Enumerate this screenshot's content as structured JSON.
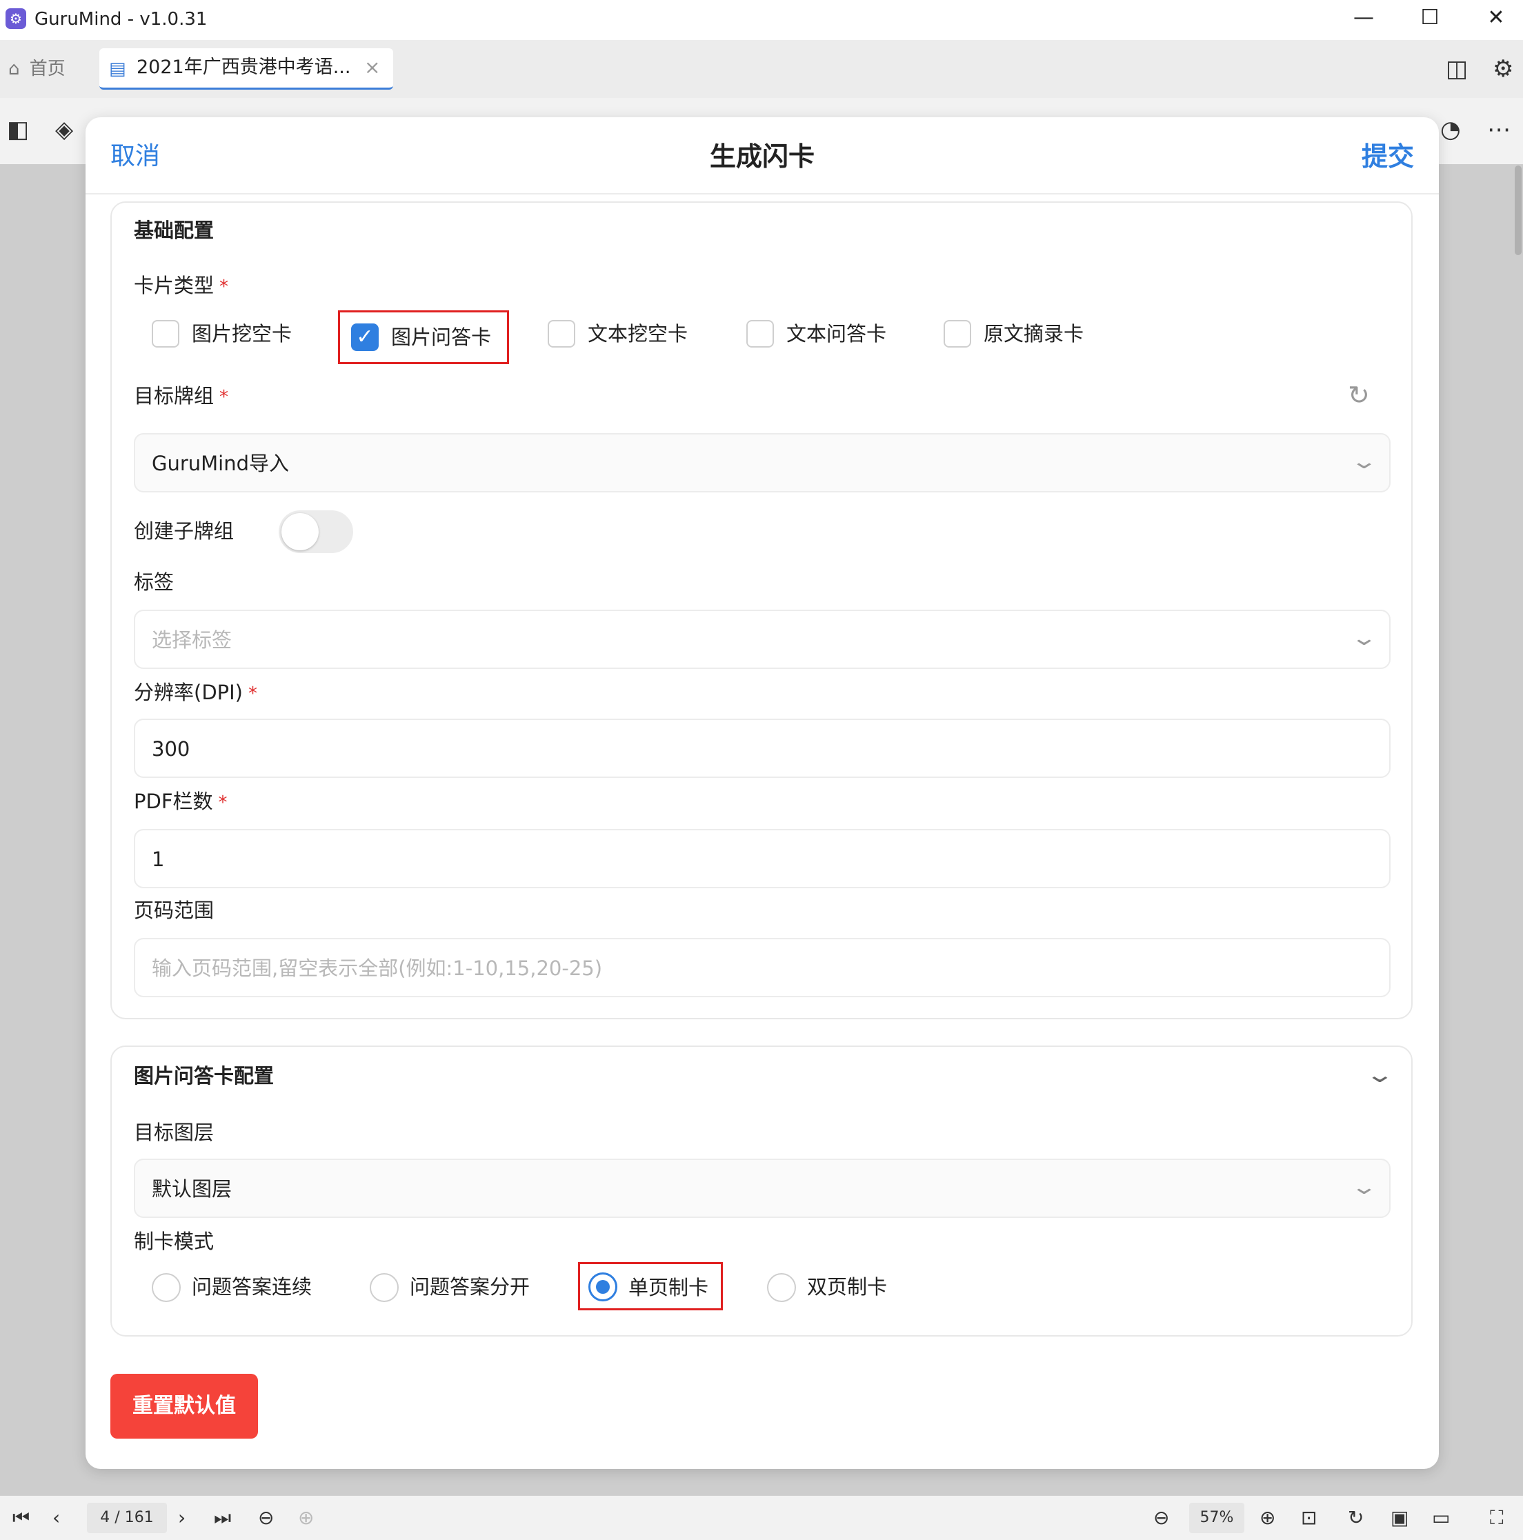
{
  "window": {
    "title": "GuruMind - v1.0.31",
    "app_icon": "app-logo-icon",
    "minimize": "—",
    "maximize": "☐",
    "close": "✕"
  },
  "tabs": {
    "home_label": "首页",
    "document_label": "2021年广西贵港中考语...",
    "close_glyph": "×"
  },
  "dialog": {
    "cancel_label": "取消",
    "title": "生成闪卡",
    "submit_label": "提交",
    "basic": {
      "section_title": "基础配置",
      "card_type_label": "卡片类型",
      "required_mark": "*",
      "card_types": [
        {
          "label": "图片挖空卡",
          "checked": false
        },
        {
          "label": "图片问答卡",
          "checked": true
        },
        {
          "label": "文本挖空卡",
          "checked": false
        },
        {
          "label": "文本问答卡",
          "checked": false
        },
        {
          "label": "原文摘录卡",
          "checked": false
        }
      ],
      "target_deck_label": "目标牌组",
      "target_deck_value": "GuruMind导入",
      "create_subdeck_label": "创建子牌组",
      "create_subdeck_on": false,
      "tags_label": "标签",
      "tags_placeholder": "选择标签",
      "dpi_label": "分辨率(DPI)",
      "dpi_value": "300",
      "pdf_columns_label": "PDF栏数",
      "pdf_columns_value": "1",
      "page_range_label": "页码范围",
      "page_range_placeholder": "输入页码范围,留空表示全部(例如:1-10,15,20-25)"
    },
    "image_qa": {
      "section_title": "图片问答卡配置",
      "target_layer_label": "目标图层",
      "target_layer_value": "默认图层",
      "mode_label": "制卡模式",
      "modes": [
        {
          "label": "问题答案连续",
          "selected": false
        },
        {
          "label": "问题答案分开",
          "selected": false
        },
        {
          "label": "单页制卡",
          "selected": true
        },
        {
          "label": "双页制卡",
          "selected": false
        }
      ]
    },
    "reset_label": "重置默认值"
  },
  "bottom_bar": {
    "page_indicator": "4 / 161",
    "zoom": "57%"
  },
  "colors": {
    "accent": "#2f7fe0",
    "danger": "#f5433a",
    "highlight": "#e02020"
  }
}
